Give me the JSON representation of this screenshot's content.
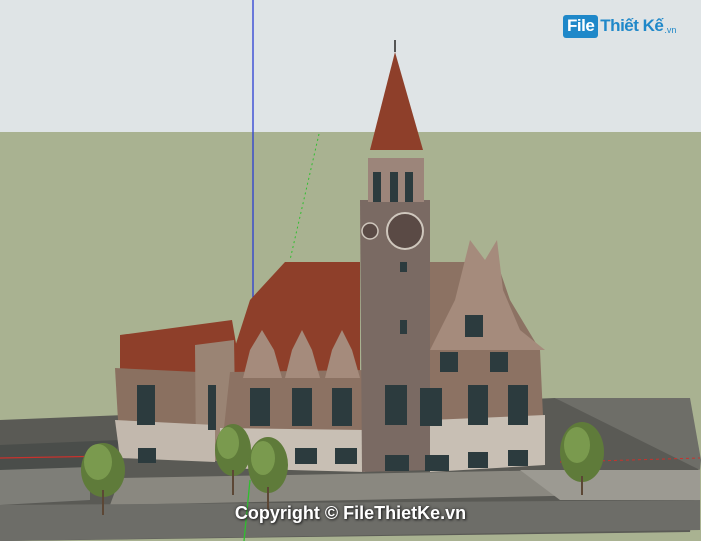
{
  "watermark_logo": {
    "box_text": "File",
    "main_text": "Thiết Kế",
    "domain_text": ".vn",
    "color": "#1f88c9"
  },
  "copyright_text": "Copyright © FileThietKe.vn",
  "colors": {
    "sky": "#dfe4e6",
    "ground": "#a9b291",
    "roof": "#8e3f2a",
    "brick": "#8c7263",
    "stone": "#c8bfb4",
    "tower": "#7a6a63",
    "axis_blue": "#2b3ed4",
    "axis_green": "#2fbf2f",
    "axis_red": "#c8322d"
  }
}
